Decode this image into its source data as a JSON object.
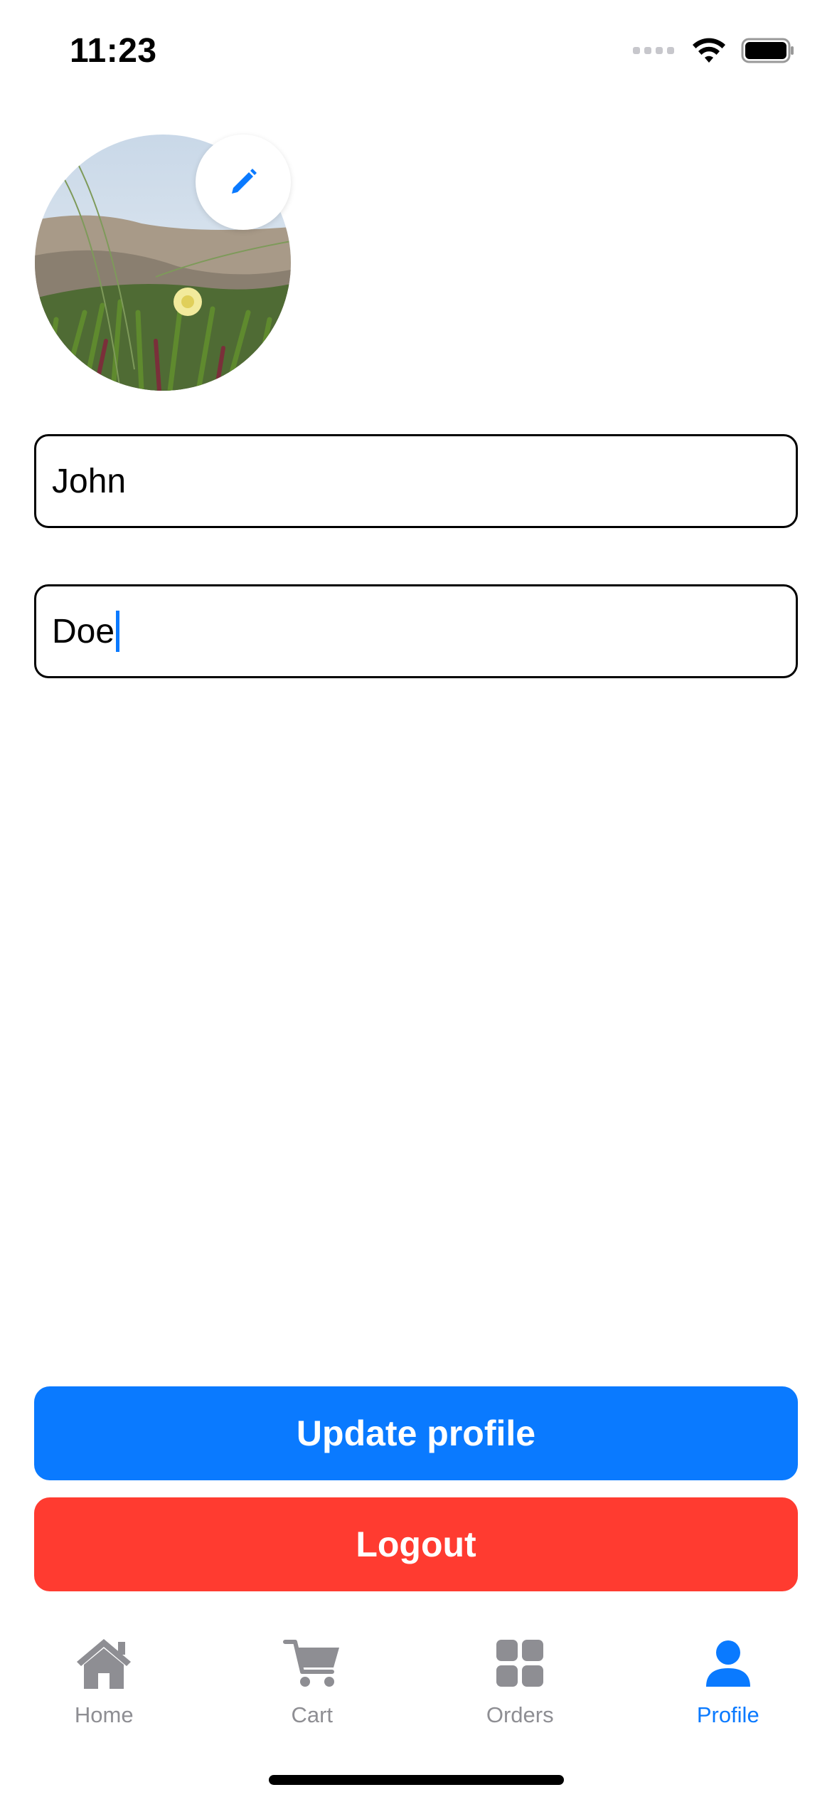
{
  "status_bar": {
    "time": "11:23"
  },
  "profile": {
    "first_name": "John",
    "last_name": "Doe"
  },
  "buttons": {
    "update_label": "Update profile",
    "logout_label": "Logout"
  },
  "tabs": [
    {
      "label": "Home",
      "icon": "home-icon",
      "active": false
    },
    {
      "label": "Cart",
      "icon": "cart-icon",
      "active": false
    },
    {
      "label": "Orders",
      "icon": "grid-icon",
      "active": false
    },
    {
      "label": "Profile",
      "icon": "person-icon",
      "active": true
    }
  ],
  "colors": {
    "accent": "#0a7aff",
    "danger": "#ff3b30",
    "inactive": "#8e8e93"
  }
}
